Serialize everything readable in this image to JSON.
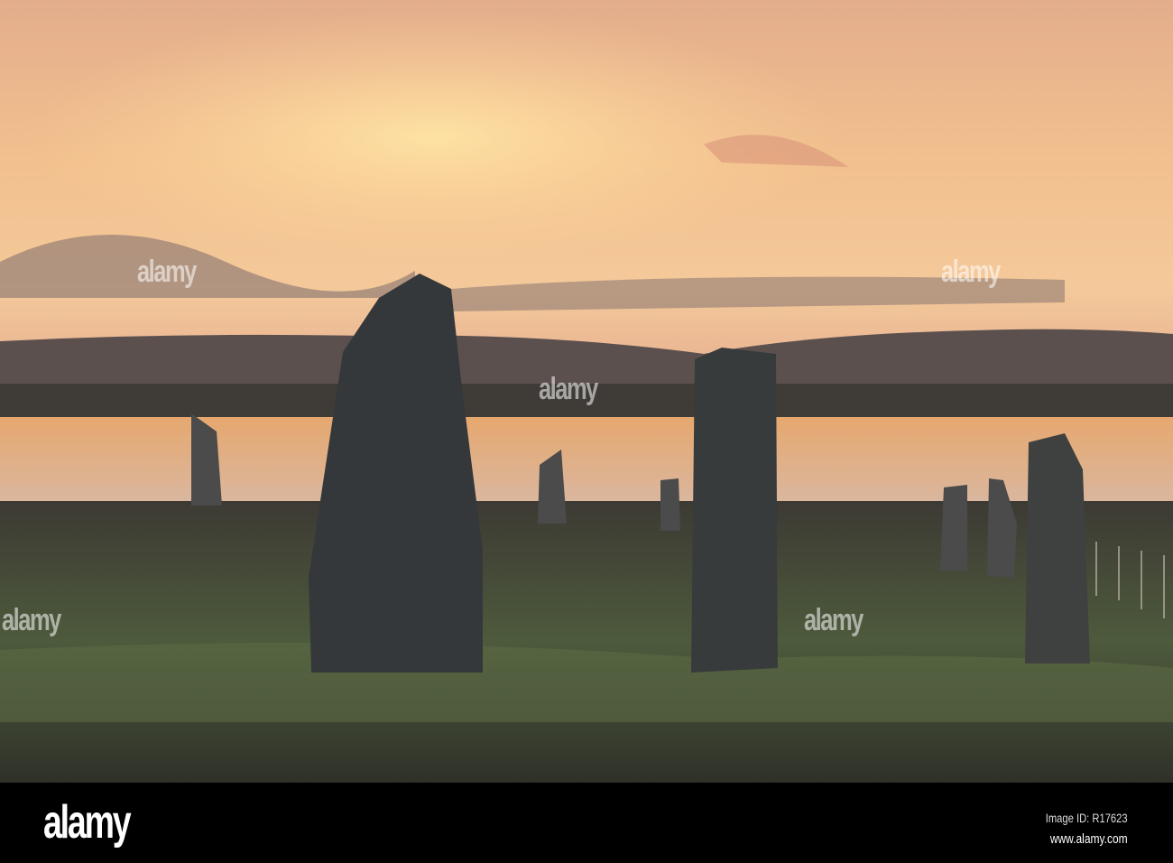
{
  "photo": {
    "subject": "standing-stones-sunset",
    "colors": {
      "sky_top": "#e8b48a",
      "sky_glow": "#f6cf8e",
      "hills": "#5e5352",
      "water": "#e9b27a",
      "grass": "#4a5238",
      "stone": "#3c3f40"
    }
  },
  "watermark": {
    "text": "alamy"
  },
  "footer": {
    "logo": "alamy",
    "image_id": "Image ID: R17623",
    "url": "www.alamy.com"
  }
}
